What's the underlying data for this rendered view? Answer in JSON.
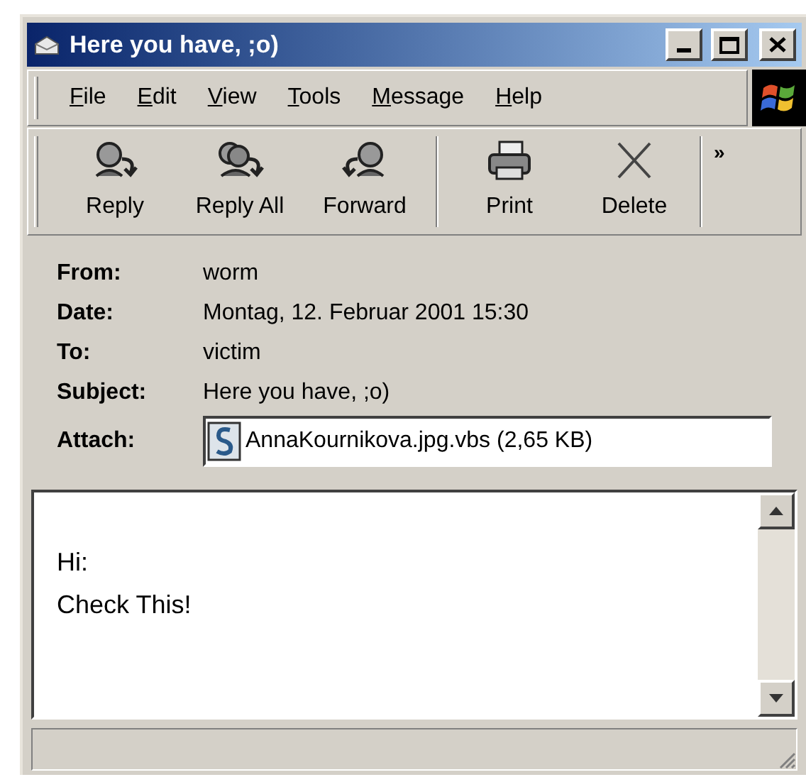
{
  "window": {
    "title": "Here you have, ;o)"
  },
  "menu": [
    "File",
    "Edit",
    "View",
    "Tools",
    "Message",
    "Help"
  ],
  "toolbar": {
    "buttons": [
      {
        "kind": "reply",
        "label": "Reply"
      },
      {
        "kind": "reply_all",
        "label": "Reply All"
      },
      {
        "kind": "forward",
        "label": "Forward"
      },
      {
        "kind": "print",
        "label": "Print"
      },
      {
        "kind": "delete",
        "label": "Delete"
      }
    ],
    "overflow": "»"
  },
  "header": [
    {
      "label": "From:",
      "value": "worm"
    },
    {
      "label": "Date:",
      "value": "Montag, 12. Februar 2001 15:30"
    },
    {
      "label": "To:",
      "value": "victim"
    },
    {
      "label": "Subject:",
      "value": "Here you have, ;o)"
    }
  ],
  "attachment": {
    "label": "Attach:",
    "file": "AnnaKournikova.jpg.vbs (2,65 KB)"
  },
  "body": [
    "Hi:",
    "Check This!"
  ]
}
